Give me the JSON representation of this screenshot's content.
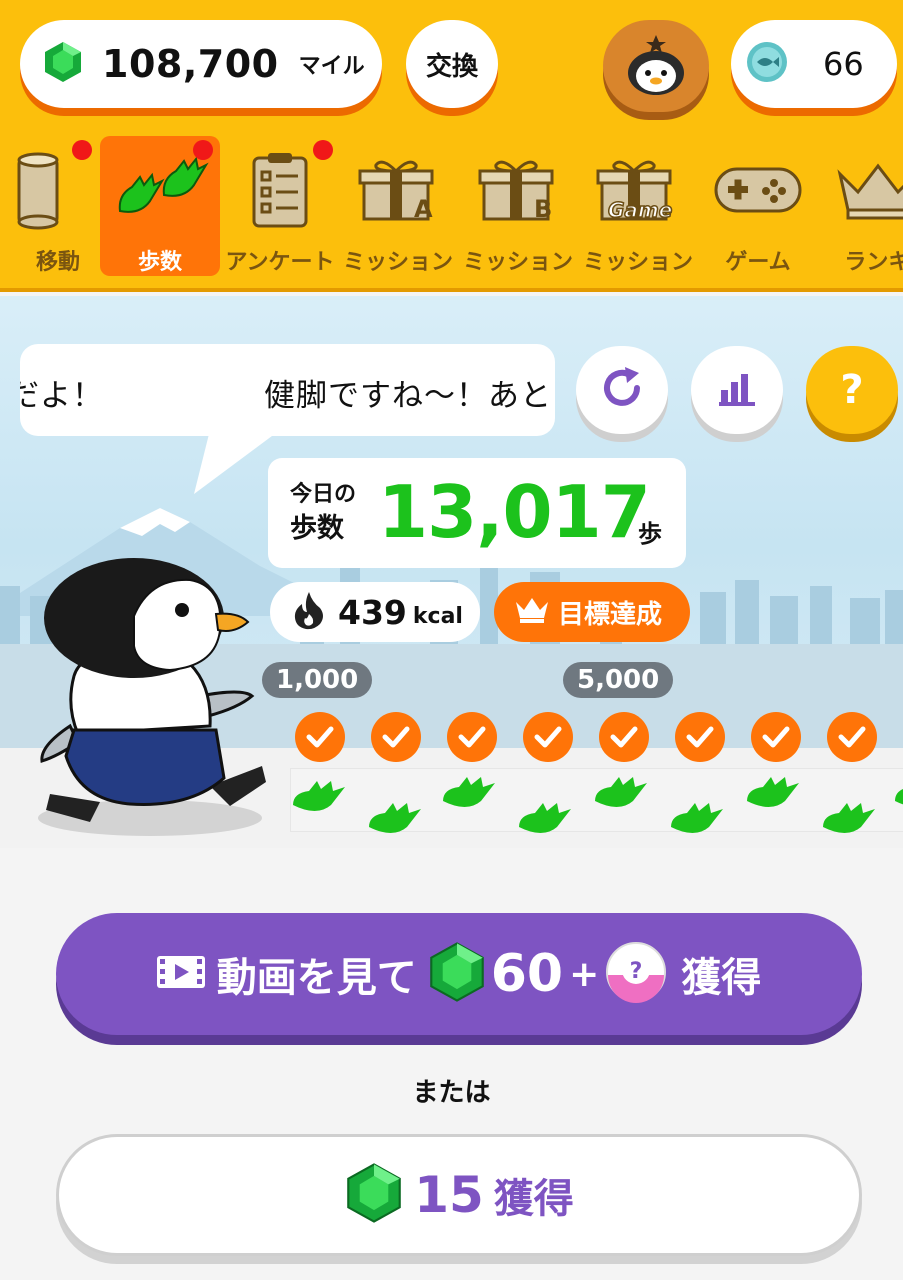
{
  "header": {
    "miles_value": "108,700",
    "miles_unit": "マイル",
    "exchange_label": "交換",
    "coin_value": "66"
  },
  "nav": {
    "items": [
      {
        "label": "移動",
        "icon": "cylinder-icon",
        "badge": true
      },
      {
        "label": "歩数",
        "icon": "footprints-icon",
        "badge": true,
        "active": true
      },
      {
        "label": "アンケート",
        "icon": "clipboard-icon",
        "badge": true
      },
      {
        "label": "ミッション",
        "icon": "gift-a-icon",
        "badge": false
      },
      {
        "label": "ミッション",
        "icon": "gift-b-icon",
        "badge": false
      },
      {
        "label": "ミッション",
        "icon": "gift-game-icon",
        "badge": false
      },
      {
        "label": "ゲーム",
        "icon": "gamepad-icon",
        "badge": false
      },
      {
        "label": "ランキン",
        "icon": "crown-icon",
        "badge": false
      }
    ]
  },
  "speech": {
    "text": "だよ！　　　　　健脚ですね〜！あと"
  },
  "steps": {
    "label_line1": "今日の",
    "label_line2": "歩数",
    "value": "13,017",
    "unit": "歩"
  },
  "calories": {
    "value": "439",
    "unit": "kcal"
  },
  "goal_badge": "目標達成",
  "markers": [
    "1,000",
    "5,000"
  ],
  "checkpoints_done": 8,
  "video_button": {
    "label": "動画を見て",
    "gems": "60",
    "plus": "+",
    "suffix": "獲得"
  },
  "or_text": "または",
  "earn_button": {
    "gems": "15",
    "suffix": "獲得"
  },
  "colors": {
    "header": "#fcbf0c",
    "accent_orange": "#ff7408",
    "steps_green": "#1cc21c",
    "purple": "#7e54c2"
  }
}
